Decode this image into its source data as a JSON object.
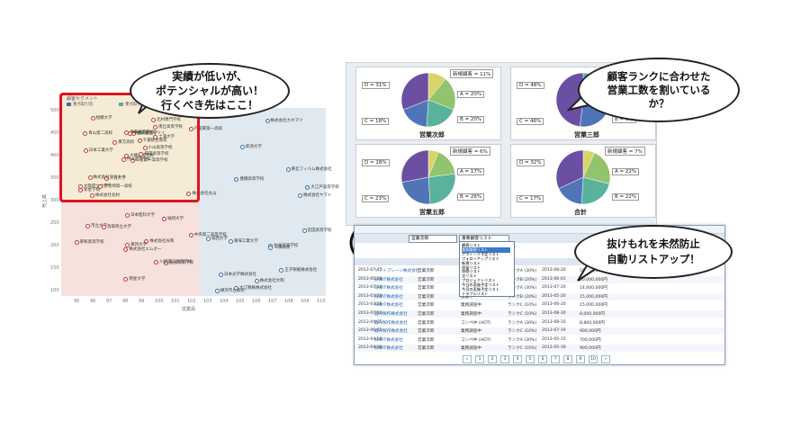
{
  "left": {
    "bubble_lines": [
      "実績が低いが、",
      "ポテンシャルが高い！",
      "行くべき先はここ！"
    ],
    "legend_title": "顧客セグメント",
    "legend_items": [
      "重点取引先",
      "重点取引先候補"
    ],
    "y_axis_label": "売上高",
    "x_axis_label": "従業員",
    "y_ticks": [
      "500",
      "450",
      "400",
      "350",
      "300",
      "250",
      "200",
      "150",
      "100"
    ],
    "x_ticks": [
      "95",
      "96",
      "97",
      "98",
      "99",
      "100",
      "101",
      "102",
      "103",
      "104",
      "105",
      "106",
      "107",
      "108",
      "109",
      "110"
    ],
    "points": [
      {
        "label": "二宮第一高等学校",
        "c": "r"
      },
      {
        "label": "青山第二高校",
        "c": "r"
      },
      {
        "label": "大横高等学校",
        "c": "r"
      },
      {
        "label": "大阪府立大学",
        "c": "r"
      },
      {
        "label": "小山高等学校",
        "c": "r"
      },
      {
        "label": "大谷大学",
        "c": "r"
      },
      {
        "label": "北村専門学校",
        "c": "r"
      },
      {
        "label": "株式会社ミツイ",
        "c": "r"
      },
      {
        "label": "南丘高等学校",
        "c": "r"
      },
      {
        "label": "稲森高等学校",
        "c": "r"
      },
      {
        "label": "相模大学",
        "c": "r"
      },
      {
        "label": "株式会社丸山",
        "c": "r"
      },
      {
        "label": "日本工業大学",
        "c": "r"
      },
      {
        "label": "戸田東第一高校",
        "c": "r"
      },
      {
        "label": "伊山高等学校",
        "c": "r"
      },
      {
        "label": "土浦大学",
        "c": "r"
      },
      {
        "label": "株式会社北村",
        "c": "r"
      },
      {
        "label": "清和高等学校",
        "c": "r"
      },
      {
        "label": "千葉総合高校",
        "c": "r"
      },
      {
        "label": "株式会社ワタナベ",
        "c": "r"
      },
      {
        "label": "東方高校",
        "c": "r"
      },
      {
        "label": "新星学院",
        "c": "r"
      },
      {
        "label": "伊勢崎第一高校",
        "c": "r"
      },
      {
        "label": "中国工業大学",
        "c": "r"
      },
      {
        "label": "株式会社光和",
        "c": "r"
      },
      {
        "label": "鹿島高等学校",
        "c": "r"
      },
      {
        "label": "市立大学",
        "c": "r"
      },
      {
        "label": "日本医科大学",
        "c": "r"
      },
      {
        "label": "東和高等学校",
        "c": "r"
      },
      {
        "label": "川越第二高等学校",
        "c": "r"
      },
      {
        "label": "中央第二高等学校",
        "c": "r"
      },
      {
        "label": "株式会社エムオー",
        "c": "r"
      },
      {
        "label": "明星大学",
        "c": "r"
      },
      {
        "label": "東邦大学",
        "c": "r"
      },
      {
        "label": "鳥取県立大学",
        "c": "r"
      },
      {
        "label": "福岡大学",
        "c": "r"
      },
      {
        "label": "豊橋高等学校",
        "c": "b"
      },
      {
        "label": "株式会社ヤマト",
        "c": "b"
      },
      {
        "label": "大江戸高等学校",
        "c": "b"
      },
      {
        "label": "東北フィルム株式会社",
        "c": "b"
      },
      {
        "label": "株式会社カネマツ",
        "c": "b"
      },
      {
        "label": "新潟大学",
        "c": "b"
      },
      {
        "label": "東海工業大学",
        "c": "b"
      },
      {
        "label": "王子製紙株式会社",
        "c": "b"
      },
      {
        "label": "大江製紙株式会社",
        "c": "b"
      },
      {
        "label": "城西大学",
        "c": "b"
      },
      {
        "label": "仙北高等学校",
        "c": "b"
      },
      {
        "label": "横浜市立高校",
        "c": "b"
      },
      {
        "label": "株式会社大和",
        "c": "b"
      },
      {
        "label": "三陽高校",
        "c": "b"
      },
      {
        "label": "日本光学株式会社",
        "c": "b"
      },
      {
        "label": "宮田高等学校",
        "c": "b"
      }
    ]
  },
  "right": {
    "bubble1_lines": [
      "顧客ランクに合わせた",
      "営業工数を割いている",
      "か？"
    ],
    "bubble2_lines": [
      "抜けもれを未然防止",
      "自動リストアップ！"
    ],
    "pies": [
      {
        "title": "営業次郎",
        "labels": [
          "新規顧客 = 11%",
          "A = 20%",
          "B = 20%",
          "C = 18%",
          "D = 31%"
        ]
      },
      {
        "title": "営業三郎",
        "labels": [
          "新規顧客 = 0%",
          "A = 0%",
          "B = 6%",
          "C = 46%",
          "D = 48%"
        ]
      },
      {
        "title": "営業五郎",
        "labels": [
          "新規顧客 = 6%",
          "A = 17%",
          "B = 26%",
          "C = 23%",
          "D = 28%"
        ]
      },
      {
        "title": "合計",
        "labels": [
          "新規顧客 = 7%",
          "A = 22%",
          "B = 22%",
          "C = 17%",
          "D = 32%"
        ]
      }
    ],
    "pie_colors": [
      "#d9d36a",
      "#92c36d",
      "#59b29b",
      "#4f74b7",
      "#6a4fa2",
      "#3f78a8"
    ],
    "list": {
      "dropdown_value": "営業次郎",
      "filter_value": "重要顧客リスト",
      "dropdown_items": [
        "顧客リスト",
        "重要顧客リスト",
        "アポトーク予定リスト",
        "フォローアップリスト",
        "新規リスト",
        "保留リスト",
        "休眠リスト",
        "全リスト",
        "プロジェクトリスト",
        "今日の実施予定リスト",
        "今月の実施予定リスト",
        "トラブルリスト"
      ],
      "rows": [
        [
          "2013-07-15",
          "ソフトブレーン株式会社",
          "営業次郎",
          "コンペ中 (HOT)",
          "ランクA (30%)",
          "2013-08-20",
          "10,000,000円"
        ],
        [
          "2013-05-28",
          "日本IT株式会社",
          "営業次郎",
          "提案中",
          "ランクB (20%)",
          "2013-06-01",
          "20,000,000円"
        ],
        [
          "2013-07-10",
          "日本IT株式会社",
          "営業次郎",
          "コンペ中 (HOT)",
          "ランクA (30%)",
          "2013-07-20",
          "14,600,000円"
        ],
        [
          "2013-03-10",
          "日本IT株式会社",
          "営業次郎",
          "提案中",
          "ランクB (20%)",
          "2013-05-20",
          "15,000,000円"
        ],
        [
          "2013-03-15",
          "日本IT株式会社",
          "営業次郎",
          "業務調査中",
          "ランクC (10%)",
          "2013-06-20",
          "15,000,000円"
        ],
        [
          "2013-07-10",
          "森川製作株式会社",
          "営業次郎",
          "業務調査中",
          "ランクC (10%)",
          "2013-08-30",
          "8,000,000円"
        ],
        [
          "2013-04-25",
          "森川製作株式会社",
          "営業次郎",
          "コンペ中 (HOT)",
          "ランクA (30%)",
          "2013-08-10",
          "8,800,000円"
        ],
        [
          "2013-06-15",
          "森川製作株式会社",
          "営業次郎",
          "業務調査中",
          "ランクC (10%)",
          "2013-07-19",
          "900,000円"
        ],
        [
          "2013-04-20",
          "日本IT株式会社",
          "営業次郎",
          "コンペ中 (HOT)",
          "ランクA (30%)",
          "2013-05-15",
          "700,000円"
        ],
        [
          "2013-04-30",
          "日本IT株式会社",
          "営業次郎",
          "業務調査中",
          "ランクC (10%)",
          "2013-05-30",
          "900,000円"
        ]
      ],
      "pages": [
        "«",
        "1",
        "2",
        "3",
        "4",
        "5",
        "6",
        "7",
        "8",
        "9",
        "10",
        "»"
      ]
    }
  }
}
